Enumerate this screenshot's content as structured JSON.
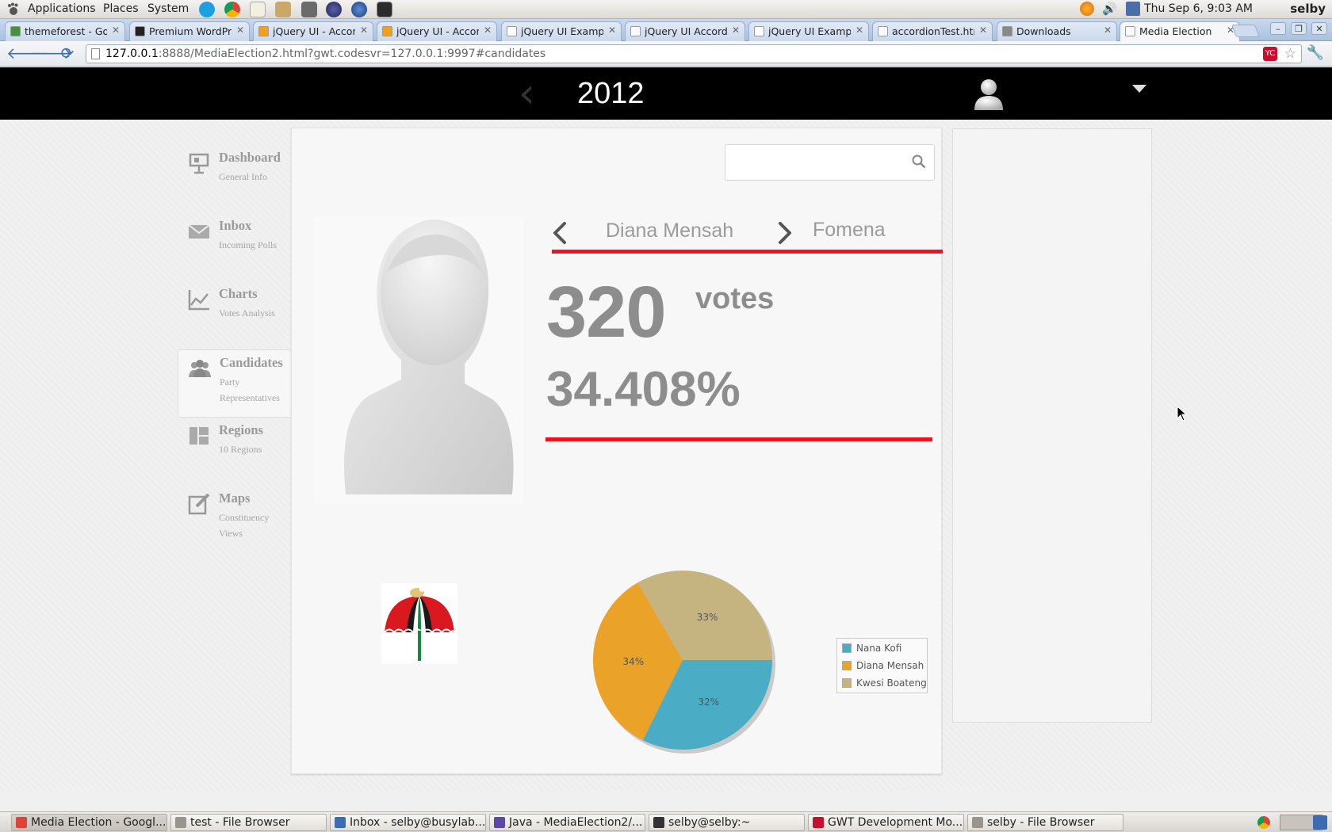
{
  "desktop": {
    "menus": [
      "Applications",
      "Places",
      "System"
    ],
    "clock": "Thu Sep  6,  9:03 AM",
    "username": "selby"
  },
  "browser": {
    "tabs": [
      {
        "title": "themeforest - Goo",
        "favicon_color": "#4a8f3c"
      },
      {
        "title": "Premium WordPre",
        "favicon_color": "#222222"
      },
      {
        "title": "jQuery UI - Accor",
        "favicon_color": "#f6a01a"
      },
      {
        "title": "jQuery UI - Accor",
        "favicon_color": "#f6a01a"
      },
      {
        "title": "jQuery UI Exampl",
        "favicon_color": "#ffffff"
      },
      {
        "title": "jQuery UI Accordi",
        "favicon_color": "#ffffff"
      },
      {
        "title": "jQuery UI Examp",
        "favicon_color": "#ffffff"
      },
      {
        "title": "accordionTest.htm",
        "favicon_color": "#ffffff"
      },
      {
        "title": "Downloads",
        "favicon_color": "#888888"
      },
      {
        "title": "Media Election",
        "favicon_color": "#ffffff"
      }
    ],
    "active_tab_index": 9,
    "url_host": "127.0.0.1",
    "url_rest": ":8888/MediaElection2.html?gwt.codesvr=127.0.0.1:9997#candidates",
    "ext_badge": "YC"
  },
  "app": {
    "year": "2012",
    "prev_arrow": "‹",
    "sidebar": [
      {
        "title": "Dashboard",
        "subtitle": "General Info",
        "icon": "presentation-icon",
        "active": false
      },
      {
        "title": "Inbox",
        "subtitle": "Incoming Polls",
        "icon": "envelope-icon",
        "active": false
      },
      {
        "title": "Charts",
        "subtitle": "Votes Analysis",
        "icon": "line-chart-icon",
        "active": false
      },
      {
        "title": "Candidates",
        "subtitle": "Party Representatives",
        "icon": "people-icon",
        "active": true
      },
      {
        "title": "Regions",
        "subtitle": "10 Regions",
        "icon": "regions-icon",
        "active": false
      },
      {
        "title": "Maps",
        "subtitle": "Constituency Views",
        "icon": "edit-icon",
        "active": false
      }
    ],
    "search": {
      "placeholder": ""
    },
    "candidate": {
      "name": "Diana Mensah",
      "constituency": "Fomena",
      "votes": "320",
      "votes_unit": "votes",
      "percentage": "34.408%"
    },
    "accent_color": "#e8161e"
  },
  "chart_data": {
    "type": "pie",
    "series": [
      {
        "name": "Nana Kofi",
        "value": 32,
        "label": "32%",
        "color": "#4bacc6"
      },
      {
        "name": "Diana Mensah",
        "value": 34,
        "label": "34%",
        "color": "#eaa228"
      },
      {
        "name": "Kwesi Boateng",
        "value": 33,
        "label": "33%",
        "color": "#c5b47f"
      }
    ],
    "legend_position": "right"
  },
  "taskbar": [
    {
      "label": "Media Election - Googl...",
      "icon_color": "#db4437",
      "active": true
    },
    {
      "label": "test - File Browser",
      "icon_color": "#9a958c",
      "active": false
    },
    {
      "label": "Inbox - selby@busylab...",
      "icon_color": "#3c6db0",
      "active": false
    },
    {
      "label": "Java - MediaElection2/...",
      "icon_color": "#5b4aa3",
      "active": false
    },
    {
      "label": "selby@selby:~",
      "icon_color": "#333333",
      "active": false
    },
    {
      "label": "GWT Development Mo...",
      "icon_color": "#c8102e",
      "active": false
    },
    {
      "label": "selby - File Browser",
      "icon_color": "#9a958c",
      "active": false
    }
  ]
}
